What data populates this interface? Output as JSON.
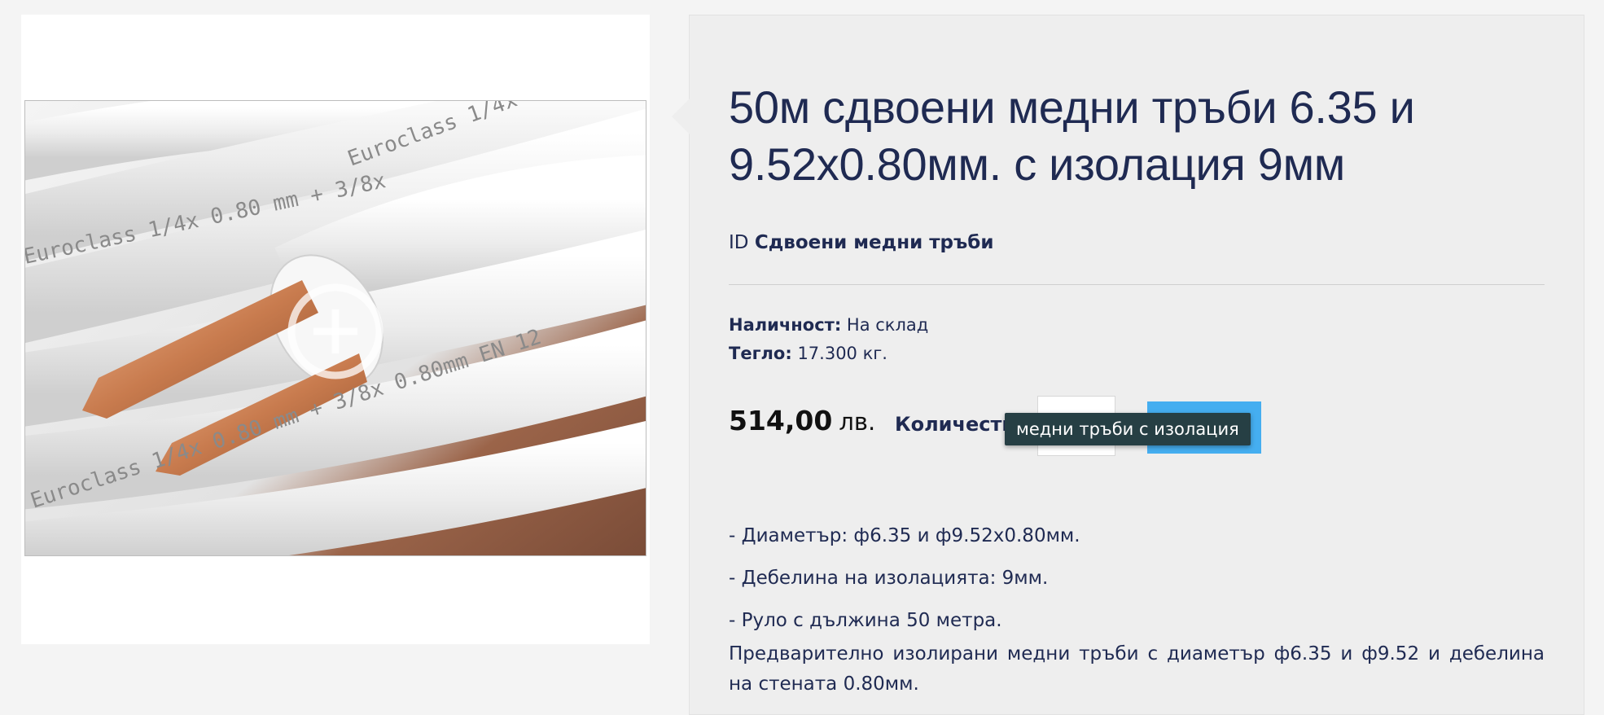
{
  "product": {
    "title": "50м сдвоени медни тръби 6.35 и 9.52x0.80мм. с изолация 9мм",
    "id_label": "ID",
    "id_value": "Сдвоени медни тръби",
    "availability_label": "Наличност:",
    "availability_value": "На склад",
    "weight_label": "Тегло:",
    "weight_value": "17.300 кг.",
    "price_amount": "514,00",
    "price_currency": "лв.",
    "quantity_label": "Количество",
    "quantity_value": "",
    "tooltip": "медни тръби с изолация",
    "description": {
      "lines": [
        "- Диаметър: ф6.35 и ф9.52x0.80мм.",
        "- Дебелина на изолацията: 9мм.",
        "- Руло с дължина 50 метра."
      ],
      "paragraph": "Предварително изолирани медни тръби с диаметър ф6.35 и ф9.52 и дебелина на стената 0.80мм."
    }
  },
  "image": {
    "printed_text": [
      "Euroclass 1/4x 0.80mm + 3/8x 0.80mm EN",
      "Euroclass 1/4x 0.80 mm + 3/8x",
      "Euroclass 1/4x 0.80 mm + 3/8x 0.80mm EN 12"
    ],
    "zoom_icon": "zoom-in-icon"
  },
  "colors": {
    "text_primary": "#1f2a52",
    "panel_bg": "#eeeeee",
    "button": "#45aef0",
    "tooltip_bg": "#263f44"
  }
}
